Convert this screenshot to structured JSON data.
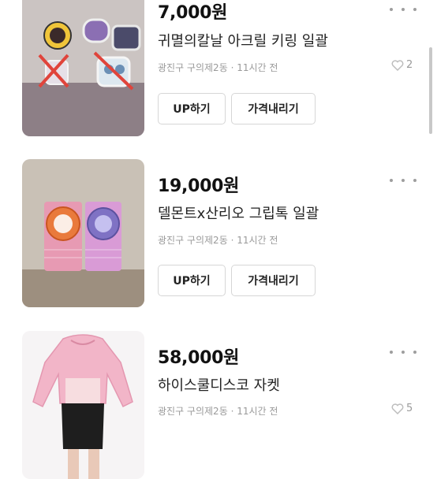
{
  "listings": [
    {
      "price": "7,000원",
      "title": "귀멸의칼날 아크릴 키링 일괄",
      "location": "광진구 구의제2동",
      "time": "11시간 전",
      "likes": "2",
      "up_label": "UP하기",
      "lower_price_label": "가격내리기"
    },
    {
      "price": "19,000원",
      "title": "델몬트x산리오 그립톡 일괄",
      "location": "광진구 구의제2동",
      "time": "11시간 전",
      "likes": "",
      "up_label": "UP하기",
      "lower_price_label": "가격내리기"
    },
    {
      "price": "58,000원",
      "title": "하이스쿨디스코 자켓",
      "location": "광진구 구의제2동",
      "time": "11시간 전",
      "likes": "5"
    }
  ],
  "separator": "·",
  "icons": {
    "more": "more-dots-icon",
    "like": "heart-icon"
  }
}
